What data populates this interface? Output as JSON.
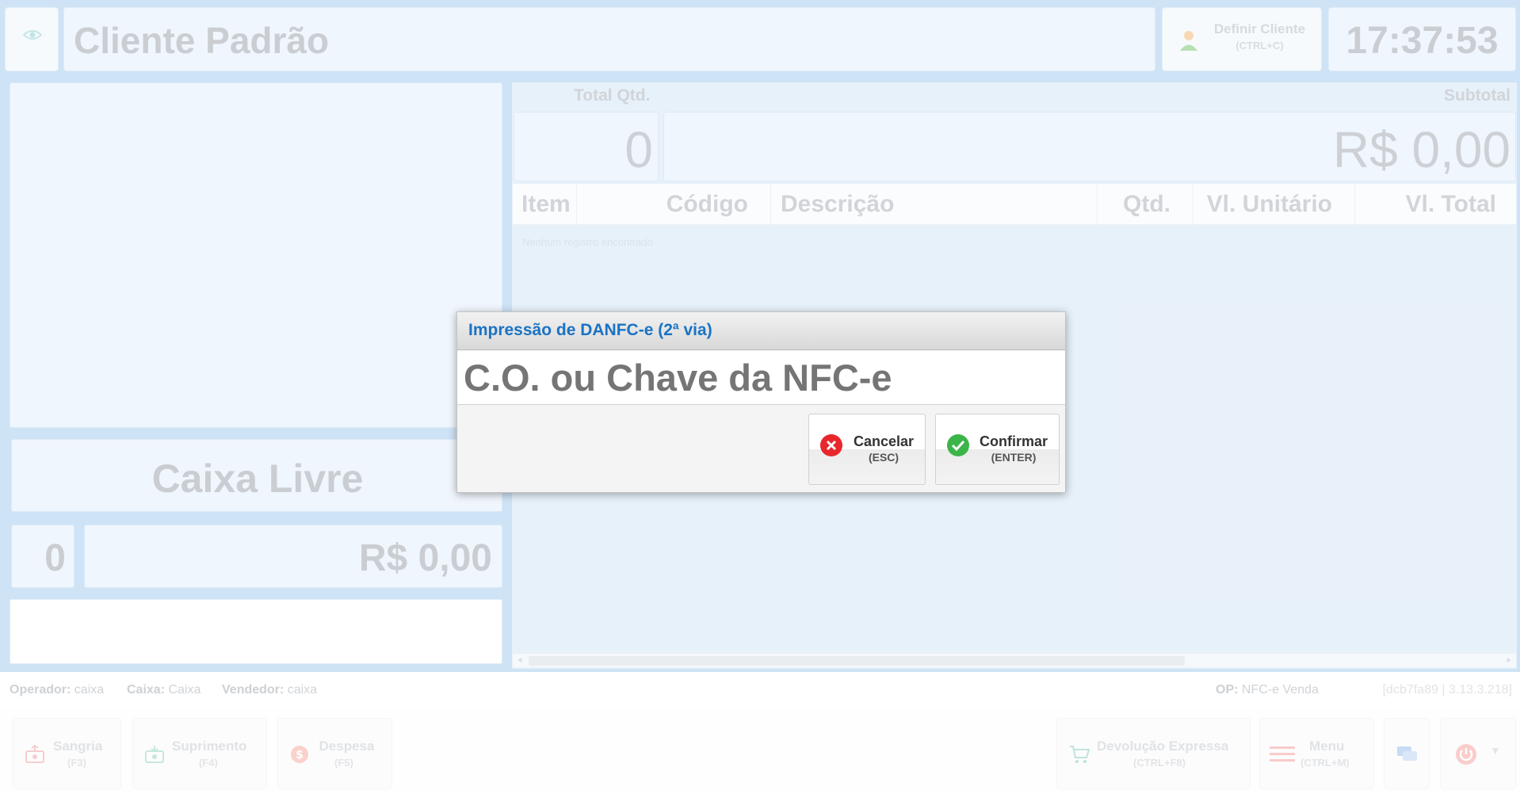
{
  "header": {
    "customer_name": "Cliente Padrão",
    "define_client": {
      "label": "Definir Cliente",
      "shortcut": "(CTRL+C)"
    },
    "clock": "17:37:53"
  },
  "left_panel": {
    "status": "Caixa Livre",
    "count": "0",
    "amount": "R$ 0,00"
  },
  "totals": {
    "qty_label": "Total Qtd.",
    "qty_value": "0",
    "subtotal_label": "Subtotal",
    "subtotal_value": "R$ 0,00"
  },
  "table": {
    "columns": [
      "Item",
      "Código",
      "Descrição",
      "Qtd.",
      "Vl. Unitário",
      "Vl. Total"
    ],
    "empty_message": "Nenhum registro encontrado"
  },
  "status_bar": {
    "operator_label": "Operador:",
    "operator_value": "caixa",
    "cashier_label": "Caixa:",
    "cashier_value": "Caixa",
    "seller_label": "Vendedor:",
    "seller_value": "caixa",
    "op_label": "OP:",
    "op_value": "NFC-e Venda",
    "version": "[dcb7fa89 | 3.13.3.218]"
  },
  "footer": {
    "sangria": {
      "label": "Sangria",
      "key": "(F3)"
    },
    "suprimento": {
      "label": "Suprimento",
      "key": "(F4)"
    },
    "despesa": {
      "label": "Despesa",
      "key": "(F5)"
    },
    "devolucao": {
      "label": "Devolução Expressa",
      "key": "(CTRL+F8)"
    },
    "menu": {
      "label": "Menu",
      "key": "(CTRL+M)"
    }
  },
  "dialog": {
    "title": "Impressão de DANFC-e (2ª via)",
    "input_placeholder": "C.O. ou Chave da NFC-e",
    "cancel": {
      "label": "Cancelar",
      "key": "(ESC)"
    },
    "confirm": {
      "label": "Confirmar",
      "key": "(ENTER)"
    }
  },
  "colors": {
    "background_blue": "#b4d5f2",
    "panel_blue": "#e8f2fc",
    "dialog_title": "#1a73c4",
    "cancel_red": "#e8262b",
    "confirm_green": "#3bb54a"
  }
}
